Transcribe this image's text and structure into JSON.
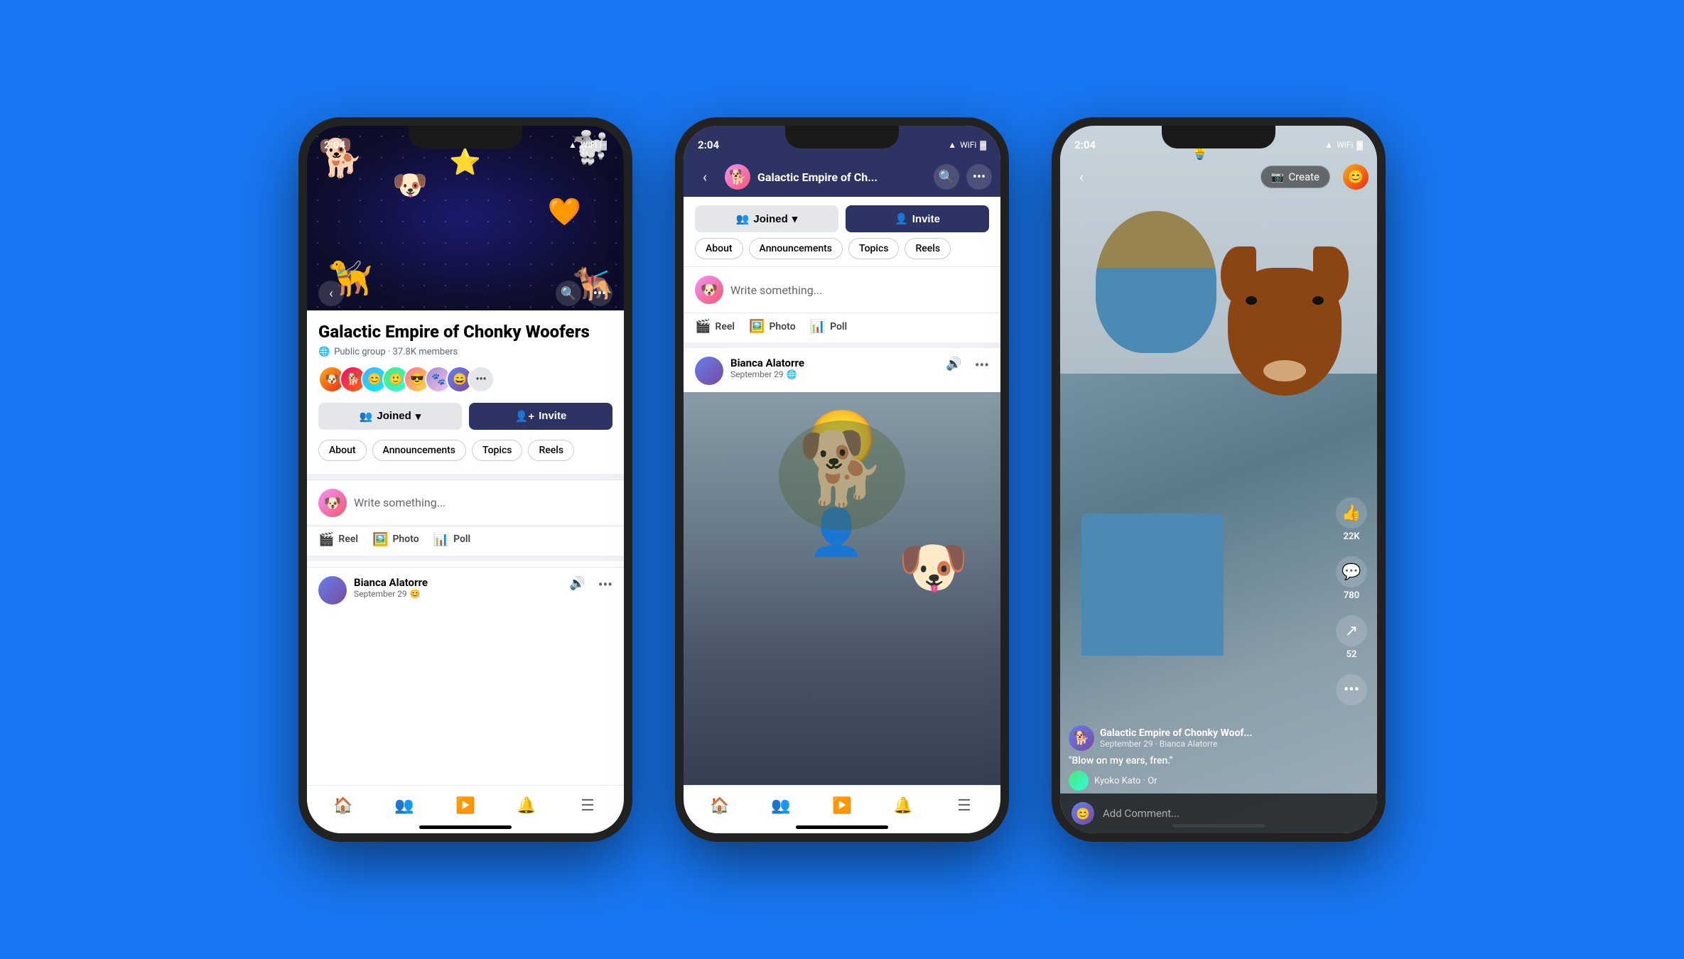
{
  "background_color": "#1877F2",
  "phone1": {
    "status_time": "2:04",
    "group_name": "Galactic Empire of Chonky Woofers",
    "group_meta": "Public group · 37.8K members",
    "btn_joined": "Joined",
    "btn_invite": "Invite",
    "tabs": [
      "About",
      "Announcements",
      "Topics",
      "Reels"
    ],
    "write_placeholder": "Write something...",
    "reel_label": "Reel",
    "photo_label": "Photo",
    "poll_label": "Poll",
    "post_name": "Bianca Alatorre",
    "post_date": "September 29",
    "bottom_nav_items": [
      "home",
      "groups",
      "video",
      "bell",
      "menu"
    ]
  },
  "phone2": {
    "status_time": "2:04",
    "group_name": "Galactic Empire of Ch...",
    "btn_joined": "Joined",
    "btn_invite": "Invite",
    "tabs": [
      "About",
      "Announcements",
      "Topics",
      "Reels"
    ],
    "write_placeholder": "Write something...",
    "reel_label": "Reel",
    "photo_label": "Photo",
    "poll_label": "Poll",
    "post_name": "Bianca Alatorre",
    "post_date": "September 29"
  },
  "phone3": {
    "status_time": "2:04",
    "create_label": "Create",
    "like_count": "22K",
    "comment_count": "780",
    "share_count": "52",
    "more_label": "...",
    "group_name": "Galactic Empire of Chonky Woof...",
    "post_date": "September 29 · Bianca Alatorre",
    "caption": "\"Blow on my ears, fren.\"",
    "commenter_name": "Kyoko Kato · Or",
    "add_comment_placeholder": "Add Comment..."
  }
}
